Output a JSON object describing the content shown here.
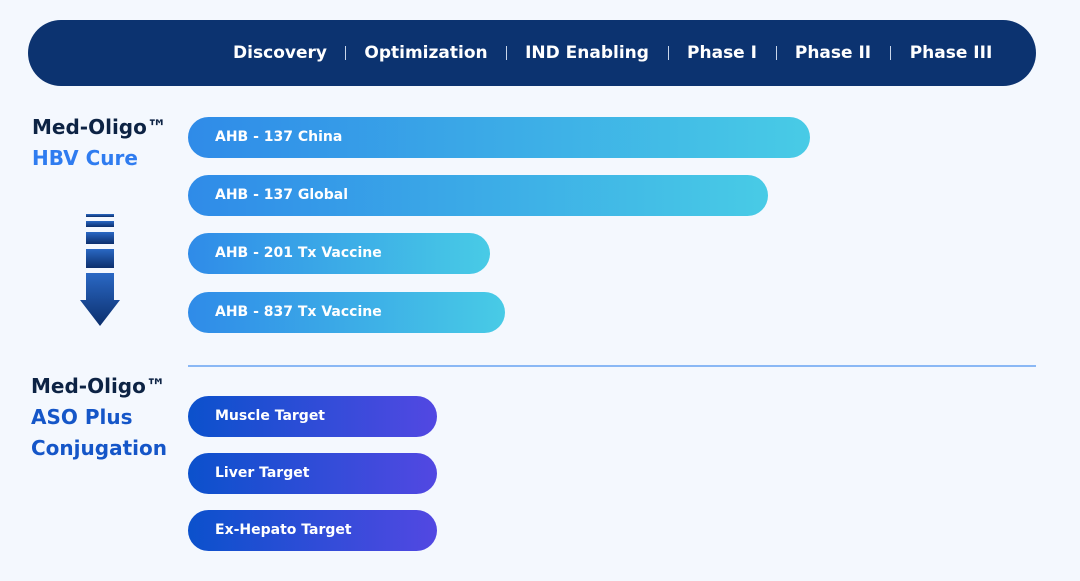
{
  "header": {
    "phases": [
      "Discovery",
      "Optimization",
      "IND Enabling",
      "Phase I",
      "Phase II",
      "Phase III"
    ],
    "color": "#0c3370"
  },
  "groups": [
    {
      "title": "Med-Oligo™",
      "subtitle_lines": [
        "HBV Cure"
      ],
      "programs": [
        {
          "label": "AHB - 137 China",
          "progress": 0.733
        },
        {
          "label": "AHB - 137 Global",
          "progress": 0.684
        },
        {
          "label": "AHB - 201 Tx Vaccine",
          "progress": 0.356
        },
        {
          "label": "AHB - 837 Tx Vaccine",
          "progress": 0.374
        }
      ]
    },
    {
      "title": "Med-Oligo™",
      "subtitle_lines": [
        "ASO Plus",
        "Conjugation"
      ],
      "programs": [
        {
          "label": "Muscle Target",
          "progress": 0.294
        },
        {
          "label": "Liver Target",
          "progress": 0.294
        },
        {
          "label": "Ex-Hepato Target",
          "progress": 0.294
        }
      ]
    }
  ],
  "icons": {
    "arrow": "down-arrow-icon"
  }
}
